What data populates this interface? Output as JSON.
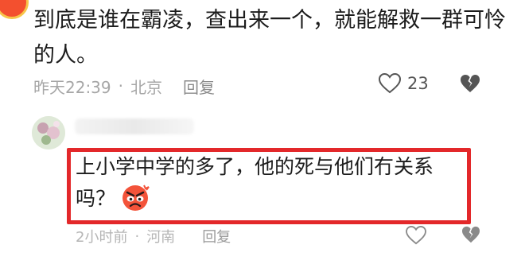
{
  "comment": {
    "text": "到底是谁在霸凌，查出来一个，就能解救一群可怜的人。",
    "time": "昨天22:39",
    "location": "北京",
    "reply_label": "回复",
    "like_count": "23"
  },
  "reply": {
    "text": "上小学中学的多了，他的死与他们冇关系吗？",
    "time": "2小时前",
    "location": "河南",
    "reply_label": "回复"
  },
  "colors": {
    "highlight_border": "#e3282a",
    "meta_text": "#a6a6a6",
    "accent_badge": "#f3502f"
  },
  "icons": {
    "like": "heart-icon",
    "dislike": "broken-heart-icon",
    "emoji": "angry-face-emoji"
  }
}
